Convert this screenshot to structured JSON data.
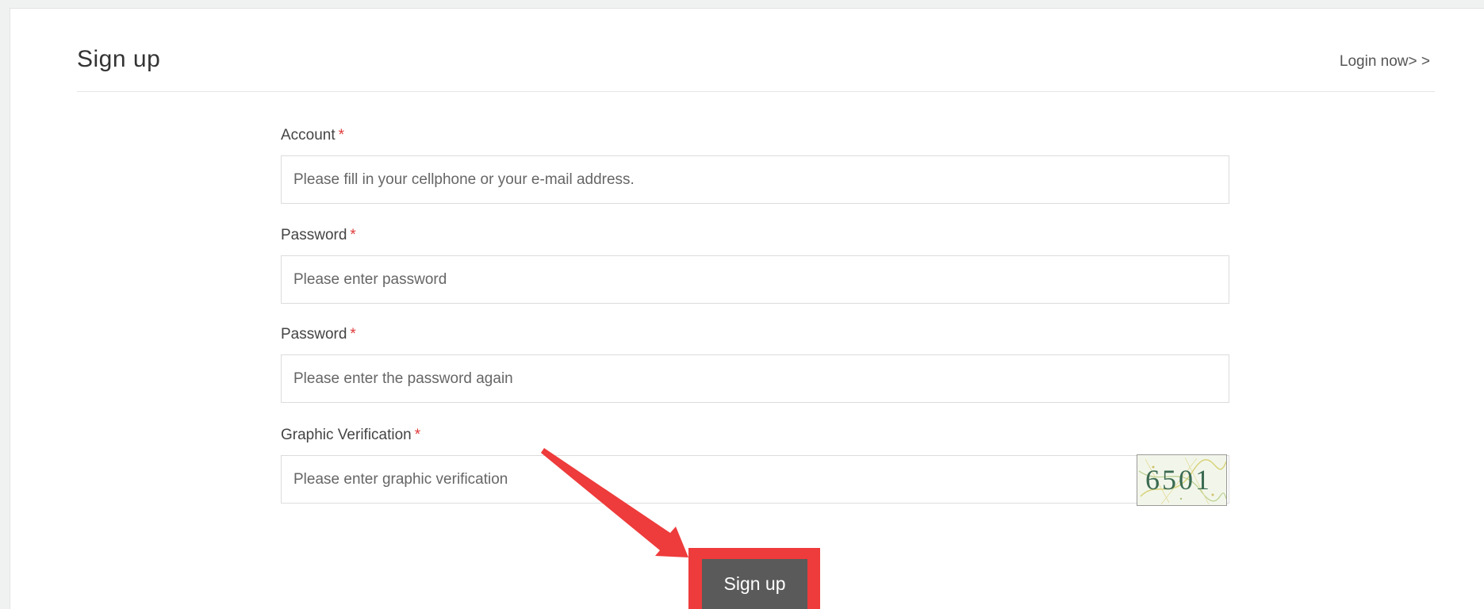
{
  "header": {
    "title": "Sign up",
    "login_link": "Login now> >"
  },
  "form": {
    "required_mark": "*",
    "account": {
      "label": "Account",
      "placeholder": "Please fill in your cellphone or your e-mail address."
    },
    "password": {
      "label": "Password",
      "placeholder": "Please enter password"
    },
    "password_confirm": {
      "label": "Password",
      "placeholder": "Please enter the password again"
    },
    "graphic_verification": {
      "label": "Graphic Verification",
      "placeholder": "Please enter graphic verification",
      "captcha_text": "6501"
    },
    "submit_label": "Sign up"
  },
  "colors": {
    "required": "#e03a3a",
    "button_bg": "#5a5a5a",
    "annotation": "#ee3b3b"
  },
  "icons": {
    "annotation": "red-arrow-icon"
  }
}
